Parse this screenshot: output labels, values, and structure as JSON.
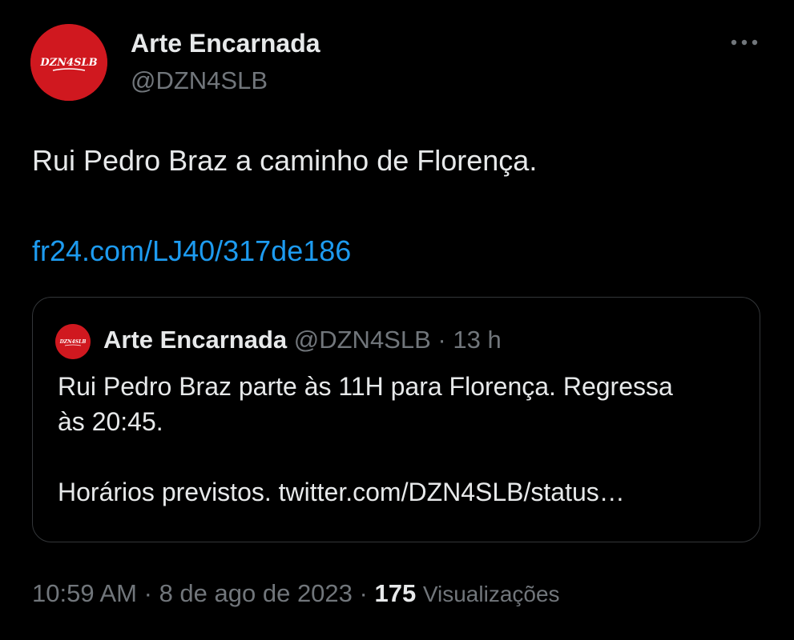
{
  "author": {
    "name": "Arte Encarnada",
    "handle": "@DZN4SLB",
    "avatar_text": "DZN4SLB",
    "avatar_color": "#d0181f"
  },
  "more_icon": "more-horizontal-icon",
  "tweet": {
    "text": "Rui Pedro Braz a caminho de Florença.",
    "link": "fr24.com/LJ40/317de186"
  },
  "quoted": {
    "name": "Arte Encarnada",
    "handle": "@DZN4SLB",
    "separator": "·",
    "time": "13 h",
    "text_line_1": "Rui Pedro Braz parte às 11H para Florença. Regressa",
    "text_line_2": "às 20:45.",
    "text_line_3": "Horários previstos. twitter.com/DZN4SLB/status…"
  },
  "meta": {
    "time": "10:59 AM",
    "sep1": "·",
    "date": "8 de ago de 2023",
    "sep2": "·",
    "views_count": "175",
    "views_label": "Visualizações"
  },
  "colors": {
    "background": "#000000",
    "text": "#e7e9ea",
    "secondary": "#71767b",
    "link": "#1d9bf0",
    "border": "#333639"
  }
}
